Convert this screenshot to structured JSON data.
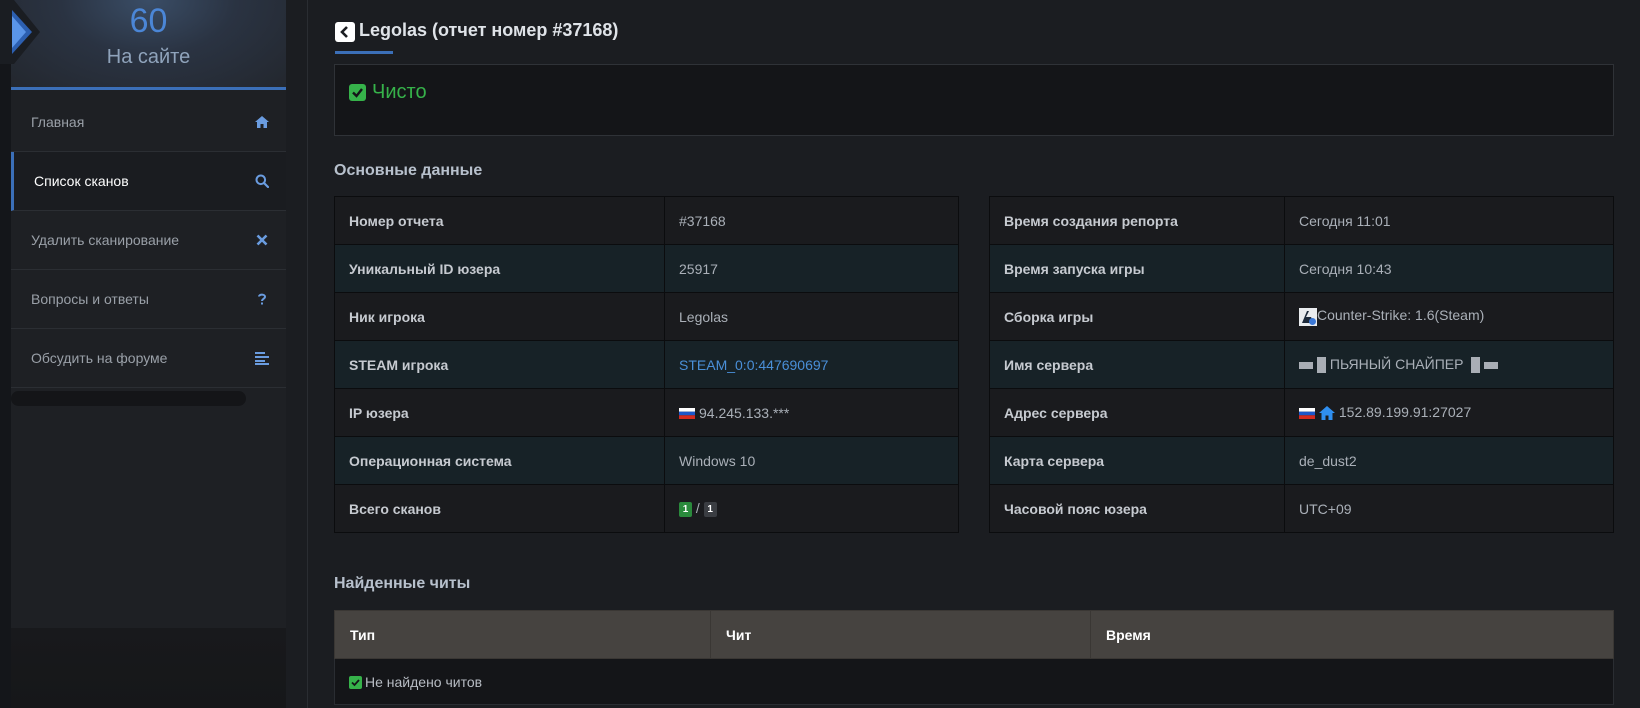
{
  "sidebar": {
    "online": {
      "count": "60",
      "label": "На сайте"
    },
    "items": [
      {
        "label": "Главная",
        "icon": "home-icon"
      },
      {
        "label": "Список сканов",
        "icon": "search-icon",
        "active": true
      },
      {
        "label": "Удалить сканирование",
        "icon": "close-icon"
      },
      {
        "label": "Вопросы и ответы",
        "icon": "question-icon"
      },
      {
        "label": "Обсудить на форуме",
        "icon": "align-left-icon"
      }
    ]
  },
  "header": {
    "title": "Legolas (отчет номер #37168)"
  },
  "status": {
    "text": "Чисто",
    "color": "#36b24a"
  },
  "main_data": {
    "title": "Основные данные",
    "left": [
      {
        "key": "Номер отчета",
        "value": "#37168"
      },
      {
        "key": "Уникальный ID юзера",
        "value": "25917"
      },
      {
        "key": "Ник игрока",
        "value": "Legolas"
      },
      {
        "key": "STEAM игрока",
        "value": "STEAM_0:0:447690697"
      },
      {
        "key": "IP юзера",
        "value": "94.245.133.***"
      },
      {
        "key": "Операционная система",
        "value": "Windows 10"
      },
      {
        "key": "Всего сканов",
        "badge_a": "1",
        "separator": "/",
        "badge_b": "1"
      }
    ],
    "right": [
      {
        "key": "Время создания репорта",
        "value": "Сегодня 11:01"
      },
      {
        "key": "Время запуска игры",
        "value": "Сегодня 10:43"
      },
      {
        "key": "Сборка игры",
        "value": "Counter-Strike: 1.6(Steam)"
      },
      {
        "key": "Имя сервера",
        "value": "ПЬЯНЫЙ СНАЙПЕР"
      },
      {
        "key": "Адрес сервера",
        "value": "152.89.199.91:27027"
      },
      {
        "key": "Карта сервера",
        "value": "de_dust2"
      },
      {
        "key": "Часовой пояс юзера",
        "value": "UTC+09"
      }
    ]
  },
  "cheats": {
    "title": "Найденные читы",
    "columns": [
      "Тип",
      "Чит",
      "Время"
    ],
    "empty_text": "Не найдено читов"
  },
  "colors": {
    "accent": "#3b6fb8",
    "link": "#4a8fd8",
    "success": "#36b24a"
  }
}
